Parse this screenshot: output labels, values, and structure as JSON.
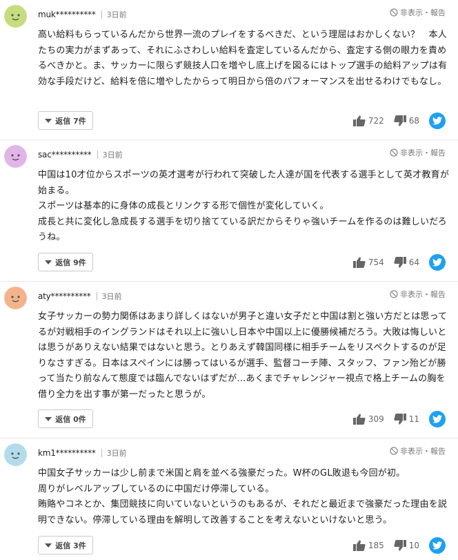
{
  "labels": {
    "hide_report": "非表示・報告"
  },
  "colors": {
    "twitter_blue": "#1da1f2",
    "icon_gray": "#666666"
  },
  "comments": [
    {
      "user": "muk**********",
      "time": "3日前",
      "avatar_color": "#c7dc7c",
      "text": "高い給料もらっているんだから世界一流のプレイをするべきだ、という理屈はおかしくない？　本人たちの実力がまずあって、それにふさわしい給料を査定しているんだから、査定する側の眼力を責めるべきかと。ま、サッカーに限らず競技人口を増やし底上げを図るにはトップ選手の給料アップは有効な手段だけど、給料を倍に増やしたからって明日から倍のパフォーマンスを出せるわけでもなし。",
      "reply_label": "返信 7件",
      "likes": "722",
      "dislikes": "68"
    },
    {
      "user": "sac**********",
      "time": "3日前",
      "avatar_color": "#e2b5e8",
      "text": "中国は10才位からスポーツの英才選考が行われて突破した人達が国を代表する選手として英才教育が始まる。\nスポーツは基本的に身体の成長とリンクする形で個性が変化していく。\n成長と共に変化し急成長する選手を切り捨てている訳だからそりゃ強いチームを作るのは難しいだろうね。",
      "reply_label": "返信 9件",
      "likes": "754",
      "dislikes": "64"
    },
    {
      "user": "aty**********",
      "time": "3日前",
      "avatar_color": "#f3b48c",
      "text": "女子サッカーの勢力関係はあまり詳しくはないが男子と違い女子だと中国は割と強い方だとは思ってるが対戦相手のイングランドはそれ以上に強いし日本や中国以上に優勝候補だろう。大敗は悔しいとは思うがありえない結果ではないと思う。とりあえず韓国同様に相手チームをリスペクトするのが足りなさすぎる。日本はスペインには勝ってはいるが選手、監督コーチ陣、スタッフ、ファン殆どが勝って当たり前なんて態度では臨んでないはずだが…あくまでチャレンジャー視点で格上チームの胸を借り全力を出す事が第一だったと思うが。",
      "reply_label": "返信 0件",
      "likes": "309",
      "dislikes": "11"
    },
    {
      "user": "km1**********",
      "time": "3日前",
      "avatar_color": "#b2dcec",
      "text": "中国女子サッカーは少し前まで米国と肩を並べる強豪だった。W杯のGL敗退も今回が初。\n周りがレベルアップしているのに中国だけ停滞している。\n賄賂やコネとか、集団競技に向いていないというのもあるが、それだと最近まで強豪だった理由を説明できない。停滞している理由を解明して改善することを考えないといけないと思う。",
      "reply_label": "返信 3件",
      "likes": "185",
      "dislikes": "10"
    }
  ]
}
